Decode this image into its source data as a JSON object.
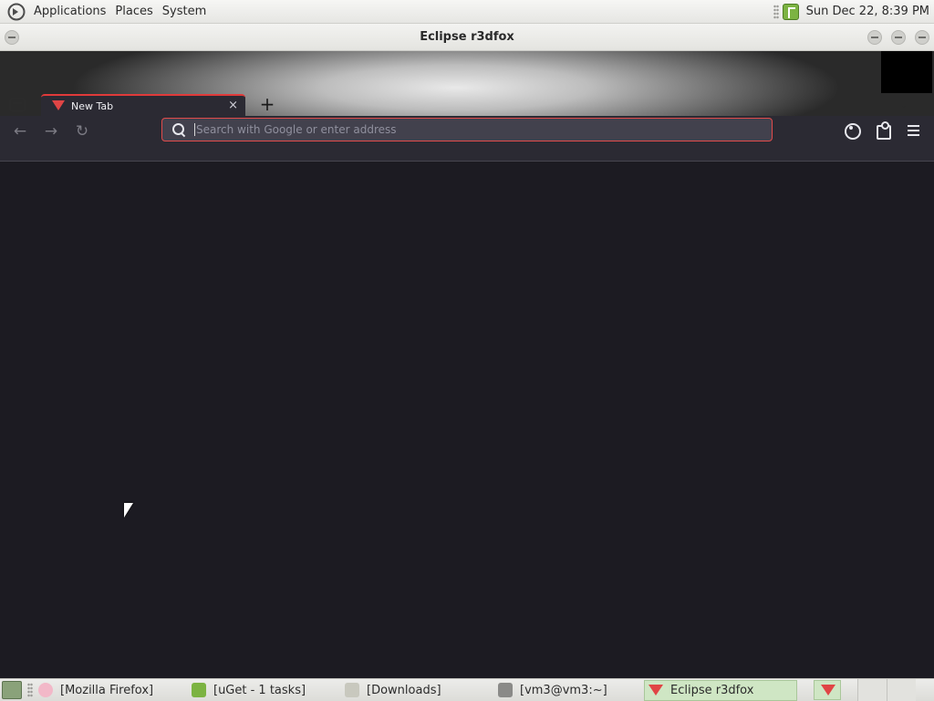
{
  "top_panel": {
    "menus": [
      "Applications",
      "Places",
      "System"
    ],
    "clock": "Sun Dec 22,  8:39 PM"
  },
  "window": {
    "title": "Eclipse r3dfox"
  },
  "tabs": [
    {
      "label": "New Tab",
      "close": "×"
    }
  ],
  "new_tab_glyph": "+",
  "tab_list_glyph": "⌄",
  "navbar": {
    "back_glyph": "←",
    "forward_glyph": "→",
    "reload_glyph": "↻",
    "url_placeholder": "Search with Google or enter address",
    "url_value": ""
  },
  "taskbar": {
    "tasks": [
      {
        "label": "[Mozilla Firefox]",
        "icon": "firefox-icon"
      },
      {
        "label": "[uGet - 1 tasks]",
        "icon": "uget-icon"
      },
      {
        "label": "[Downloads]",
        "icon": "folder-icon"
      },
      {
        "label": "[vm3@vm3:~]",
        "icon": "terminal-icon"
      },
      {
        "label": "Eclipse r3dfox",
        "icon": "r3dfox-icon",
        "active": true
      }
    ]
  },
  "colors": {
    "accent": "#e14b4b",
    "toolbar": "#2b2a33",
    "content": "#1c1b22"
  }
}
